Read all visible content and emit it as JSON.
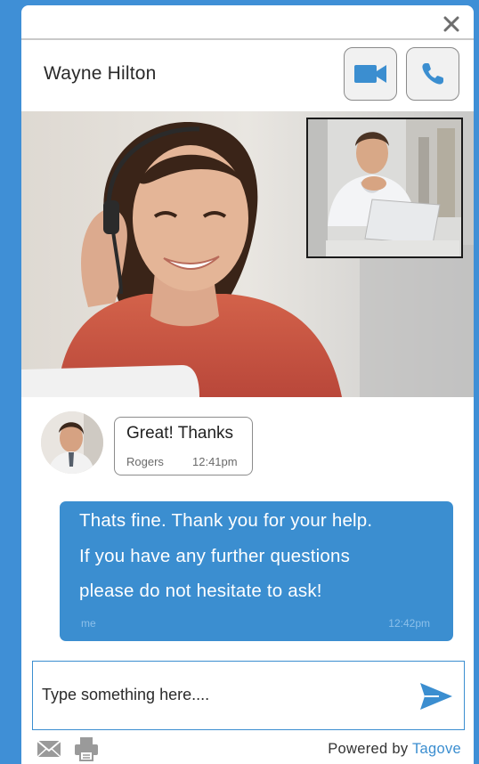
{
  "header": {
    "contact_name": "Wayne Hilton"
  },
  "icons": {
    "close": "close-icon",
    "video_call": "video-camera-icon",
    "voice_call": "phone-icon",
    "send": "send-icon",
    "email": "mail-icon",
    "print": "printer-icon"
  },
  "messages": [
    {
      "direction": "incoming",
      "text": "Great! Thanks",
      "sender": "Rogers",
      "time": "12:41pm"
    },
    {
      "direction": "outgoing",
      "lines": [
        "Thats fine. Thank you for your help.",
        "If you have any further questions",
        "please do not hesitate to ask!"
      ],
      "sender": "me",
      "time": "12:42pm"
    }
  ],
  "composer": {
    "placeholder": "Type something here....",
    "value": ""
  },
  "footer": {
    "powered_prefix": "Powered by",
    "brand": "Tagove"
  },
  "colors": {
    "page_background": "#3f8fd6",
    "accent": "#3b8ed0",
    "outgoing_bubble": "#3b8ed0",
    "button_background": "#f1f1f1"
  }
}
